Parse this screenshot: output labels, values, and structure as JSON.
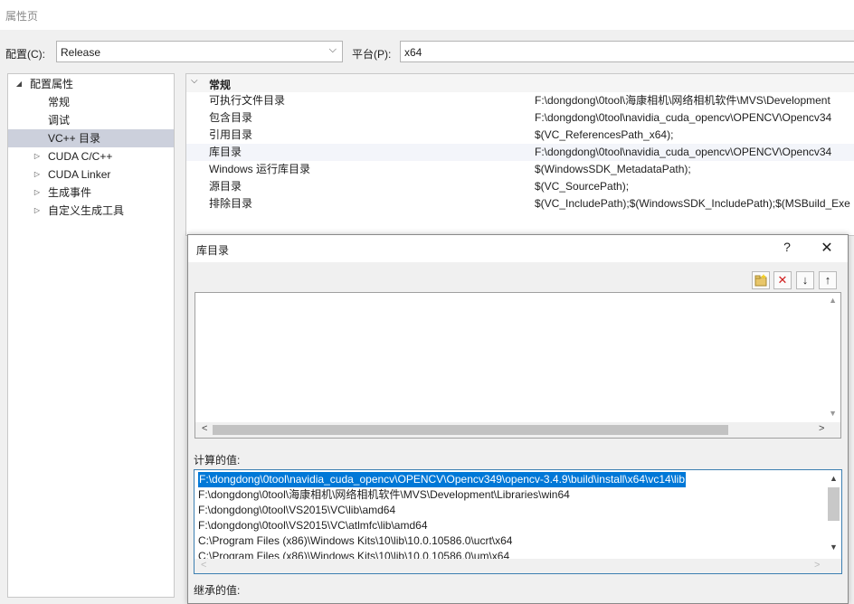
{
  "window": {
    "title": "属性页"
  },
  "config": {
    "config_label": "配置(C):",
    "config_value": "Release",
    "platform_label": "平台(P):",
    "platform_value": "x64"
  },
  "tree": {
    "root": "配置属性",
    "items": [
      "常规",
      "调试",
      "VC++ 目录",
      "CUDA C/C++",
      "CUDA Linker",
      "生成事件",
      "自定义生成工具"
    ],
    "selected": "VC++ 目录"
  },
  "properties": {
    "category": "常规",
    "rows": [
      {
        "name": "可执行文件目录",
        "value": "F:\\dongdong\\0tool\\海康相机\\网络相机软件\\MVS\\Development"
      },
      {
        "name": "包含目录",
        "value": "F:\\dongdong\\0tool\\navidia_cuda_opencv\\OPENCV\\Opencv34"
      },
      {
        "name": "引用目录",
        "value": "$(VC_ReferencesPath_x64);"
      },
      {
        "name": "库目录",
        "value": "F:\\dongdong\\0tool\\navidia_cuda_opencv\\OPENCV\\Opencv34"
      },
      {
        "name": "Windows 运行库目录",
        "value": "$(WindowsSDK_MetadataPath);"
      },
      {
        "name": "源目录",
        "value": "$(VC_SourcePath);"
      },
      {
        "name": "排除目录",
        "value": "$(VC_IncludePath);$(WindowsSDK_IncludePath);$(MSBuild_Exe"
      }
    ]
  },
  "dialog": {
    "title": "库目录",
    "help": "?",
    "close": "✕",
    "toolbar": {
      "new": "▭",
      "delete": "✕",
      "down": "↓",
      "up": "↑"
    },
    "computed_label": "计算的值:",
    "inherited_label": "继承的值:",
    "computed_values": [
      "F:\\dongdong\\0tool\\navidia_cuda_opencv\\OPENCV\\Opencv349\\opencv-3.4.9\\build\\install\\x64\\vc14\\lib",
      "F:\\dongdong\\0tool\\海康相机\\网络相机软件\\MVS\\Development\\Libraries\\win64",
      "F:\\dongdong\\0tool\\VS2015\\VC\\lib\\amd64",
      "F:\\dongdong\\0tool\\VS2015\\VC\\atlmfc\\lib\\amd64",
      "C:\\Program Files (x86)\\Windows Kits\\10\\lib\\10.0.10586.0\\ucrt\\x64",
      "C:\\Program Files (x86)\\Windows Kits\\10\\lib\\10.0.10586.0\\um\\x64"
    ]
  },
  "colors": {
    "selection": "#0078d7",
    "tree_selection": "#ccd0dc",
    "delete_icon": "#d02020"
  }
}
